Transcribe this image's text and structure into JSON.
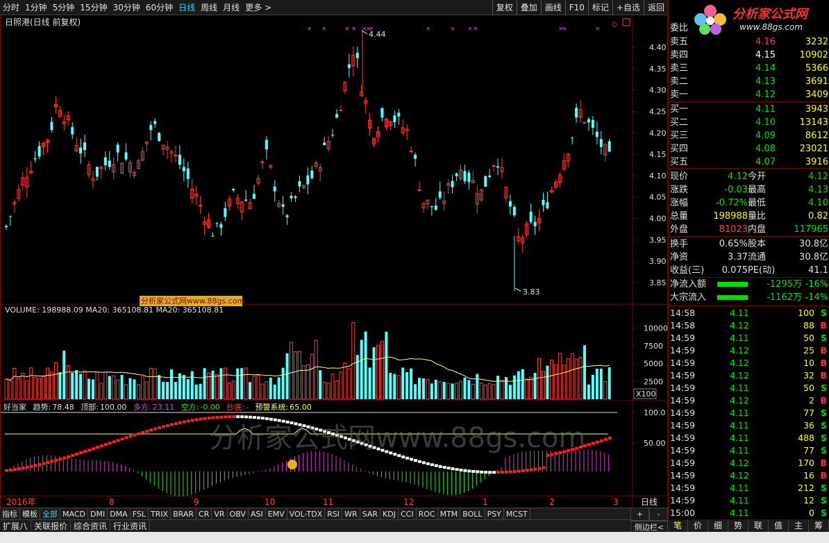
{
  "toolbar": {
    "periods": [
      "分时",
      "1分钟",
      "5分钟",
      "15分钟",
      "30分钟",
      "60分钟",
      "日线",
      "周线",
      "月线",
      "更多 >"
    ],
    "active_period": "日线",
    "tools": [
      "复权",
      "叠加",
      "画线",
      "F10",
      "标记",
      "+自选",
      "返回"
    ]
  },
  "chart": {
    "title": "日照港(日线 前复权)",
    "price_axis": [
      "4.40",
      "4.35",
      "4.30",
      "4.25",
      "4.20",
      "4.15",
      "4.10",
      "4.05",
      "4.00",
      "3.95",
      "3.90",
      "3.85"
    ],
    "high_label": "4.44",
    "low_label": "3.83",
    "watermark_small": "分析家公式网www.88gs.com",
    "volume_title": "VOLUME: 198988.09  MA20: 365108.81  MA20: 365108.81",
    "volume_axis": [
      "10000",
      "7500",
      "5000",
      "2500"
    ],
    "volume_unit": "X100",
    "indicator": {
      "name": "好当家",
      "trend_label": "趋势:",
      "trend": "78.48",
      "top_label": "顶部:",
      "top": "100.00",
      "long_label": "多方:",
      "long": "23.11",
      "short_label": "空方:",
      "short": "-0.00",
      "bottom_label": "抄底:",
      "bottom": "-",
      "alert_label": "预警系统:",
      "alert": "65.00"
    },
    "indicator_axis": [
      "100.0",
      "50.00"
    ],
    "watermark_big": "分析家公式网www.88gs.com",
    "date_axis": [
      "2016年",
      "8",
      "9",
      "10",
      "11",
      "12",
      "1",
      "2",
      "3"
    ],
    "period_label": "日线",
    "colors": {
      "up": "#ff3c3c",
      "down": "#54ffff",
      "ma": "#ffff80",
      "frame": "#7a0000"
    }
  },
  "bottom_tabs": [
    "指标",
    "模板",
    "全部",
    "MACD",
    "DMI",
    "DMA",
    "FSL",
    "TRIX",
    "BRAR",
    "CR",
    "VR",
    "OBV",
    "ASI",
    "EMV",
    "VOL-TDX",
    "RSI",
    "WR",
    "SAR",
    "KDJ",
    "CCI",
    "ROC",
    "MTM",
    "BOLL",
    "PSY",
    "MCST"
  ],
  "bottom_tabs_active": "全部",
  "bottom_bar": [
    "扩展八",
    "关联报价",
    "综合资讯",
    "行业资讯"
  ],
  "bottom_right_controls": [
    "+",
    "-",
    "侧边栏<"
  ],
  "quote": {
    "logo_text": "分析家公式网",
    "logo_url": "www.88gs.com",
    "weibi_label": "委比",
    "asks": [
      {
        "label": "卖五",
        "price": "4.16",
        "vol": "3232"
      },
      {
        "label": "卖四",
        "price": "4.15",
        "vol": "10902"
      },
      {
        "label": "卖三",
        "price": "4.14",
        "vol": "5366"
      },
      {
        "label": "卖二",
        "price": "4.13",
        "vol": "3691"
      },
      {
        "label": "卖一",
        "price": "4.12",
        "vol": "3409"
      }
    ],
    "bids": [
      {
        "label": "买一",
        "price": "4.11",
        "vol": "3943"
      },
      {
        "label": "买二",
        "price": "4.10",
        "vol": "13143"
      },
      {
        "label": "买三",
        "price": "4.09",
        "vol": "8612"
      },
      {
        "label": "买四",
        "price": "4.08",
        "vol": "23021"
      },
      {
        "label": "买五",
        "price": "4.07",
        "vol": "3916"
      }
    ],
    "stats": [
      {
        "l1": "现价",
        "v1": "4.12",
        "l2": "今开",
        "v2": "4.12"
      },
      {
        "l1": "涨跌",
        "v1": "-0.03",
        "l2": "最高",
        "v2": "4.13"
      },
      {
        "l1": "涨幅",
        "v1": "-0.72%",
        "l2": "最低",
        "v2": "4.10"
      },
      {
        "l1": "总量",
        "v1": "198988",
        "l2": "量比",
        "v2": "0.82"
      },
      {
        "l1": "外盘",
        "v1": "81023",
        "l2": "内盘",
        "v2": "117965"
      }
    ],
    "stats2": [
      {
        "l1": "换手",
        "v1": "0.65%",
        "l2": "股本",
        "v2": "30.8亿"
      },
      {
        "l1": "净资",
        "v1": "3.37",
        "l2": "流通",
        "v2": "30.8亿"
      },
      {
        "l1": "收益(三)",
        "v1": "0.075",
        "l2": "PE(动)",
        "v2": "41.1"
      }
    ],
    "flows": [
      {
        "label": "净流入额",
        "value": "-1295万",
        "pct": "-16%"
      },
      {
        "label": "大宗流入",
        "value": "-1162万",
        "pct": "-14%"
      }
    ]
  },
  "ticks": [
    {
      "t": "14:58",
      "p": "4.11",
      "v": "100",
      "s": "S"
    },
    {
      "t": "14:58",
      "p": "4.12",
      "v": "88",
      "s": "B"
    },
    {
      "t": "14:59",
      "p": "4.11",
      "v": "50",
      "s": "S"
    },
    {
      "t": "14:59",
      "p": "4.12",
      "v": "25",
      "s": "B"
    },
    {
      "t": "14:59",
      "p": "4.12",
      "v": "10",
      "s": "B"
    },
    {
      "t": "14:59",
      "p": "4.12",
      "v": "32",
      "s": "B"
    },
    {
      "t": "14:59",
      "p": "4.11",
      "v": "50",
      "s": "S"
    },
    {
      "t": "14:59",
      "p": "4.12",
      "v": "2",
      "s": "B"
    },
    {
      "t": "14:59",
      "p": "4.11",
      "v": "77",
      "s": "S"
    },
    {
      "t": "14:59",
      "p": "4.11",
      "v": "36",
      "s": "S"
    },
    {
      "t": "14:59",
      "p": "4.11",
      "v": "488",
      "s": "S"
    },
    {
      "t": "14:59",
      "p": "4.11",
      "v": "77",
      "s": "S"
    },
    {
      "t": "14:59",
      "p": "4.12",
      "v": "170",
      "s": "B"
    },
    {
      "t": "14:59",
      "p": "4.12",
      "v": "16",
      "s": "B"
    },
    {
      "t": "14:59",
      "p": "4.11",
      "v": "212",
      "s": "S"
    },
    {
      "t": "14:59",
      "p": "4.11",
      "v": "12",
      "s": "S"
    },
    {
      "t": "15:00",
      "p": "4.11",
      "v": "0",
      "s": "S"
    }
  ],
  "right_tabs": [
    "笔",
    "价",
    "细",
    "势",
    "联",
    "值",
    "主",
    "筹"
  ],
  "right_tabs_active": "笔"
}
